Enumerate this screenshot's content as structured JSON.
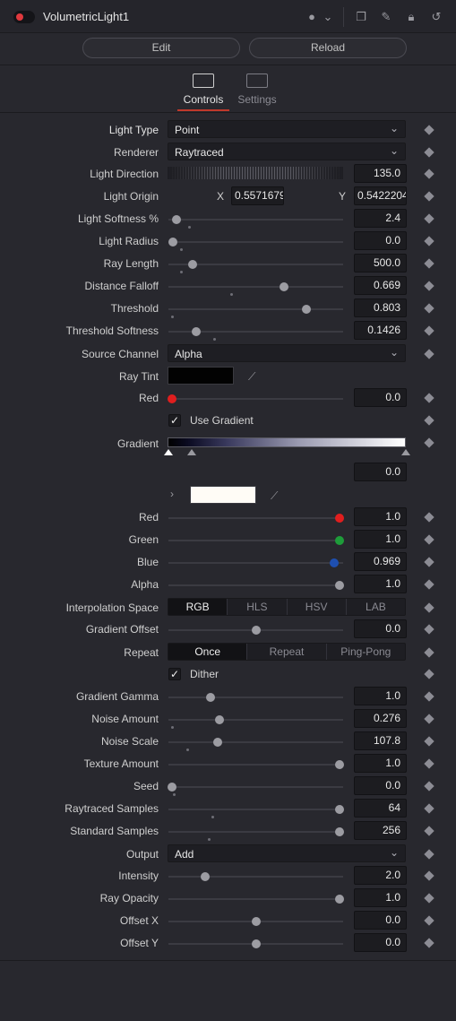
{
  "header": {
    "title": "VolumetricLight1"
  },
  "buttons": {
    "edit": "Edit",
    "reload": "Reload"
  },
  "tabs": [
    {
      "label": "Controls",
      "active": true
    },
    {
      "label": "Settings",
      "active": false
    }
  ],
  "dropdowns": {
    "light_type": {
      "label": "Light Type",
      "value": "Point"
    },
    "renderer": {
      "label": "Renderer",
      "value": "Raytraced"
    },
    "source_channel": {
      "label": "Source Channel",
      "value": "Alpha"
    },
    "output": {
      "label": "Output",
      "value": "Add"
    }
  },
  "light_direction": {
    "label": "Light Direction",
    "value": "135.0"
  },
  "light_origin": {
    "label": "Light Origin",
    "x_label": "X",
    "x": "0.5571679",
    "y_label": "Y",
    "y": "0.5422204"
  },
  "sliders": {
    "light_softness": {
      "label": "Light Softness %",
      "value": "2.4",
      "pos": 0.045,
      "sub": 0.12
    },
    "light_radius": {
      "label": "Light Radius",
      "value": "0.0",
      "pos": 0.025,
      "sub": 0.07
    },
    "ray_length": {
      "label": "Ray Length",
      "value": "500.0",
      "pos": 0.14,
      "sub": 0.07
    },
    "distance_falloff": {
      "label": "Distance Falloff",
      "value": "0.669",
      "pos": 0.66,
      "sub": 0.36
    },
    "threshold": {
      "label": "Threshold",
      "value": "0.803",
      "pos": 0.79,
      "sub": 0.02
    },
    "threshold_softness": {
      "label": "Threshold Softness",
      "value": "0.1426",
      "pos": 0.16,
      "sub": 0.26
    },
    "red": {
      "label": "Red",
      "value": "0.0",
      "pos": 0.02
    },
    "grad_red": {
      "label": "Red",
      "value": "1.0",
      "pos": 0.98
    },
    "grad_green": {
      "label": "Green",
      "value": "1.0",
      "pos": 0.98
    },
    "grad_blue": {
      "label": "Blue",
      "value": "0.969",
      "pos": 0.95
    },
    "grad_alpha": {
      "label": "Alpha",
      "value": "1.0",
      "pos": 0.98
    },
    "gradient_offset": {
      "label": "Gradient Offset",
      "value": "0.0",
      "pos": 0.5
    },
    "gradient_gamma": {
      "label": "Gradient Gamma",
      "value": "1.0",
      "pos": 0.24
    },
    "noise_amount": {
      "label": "Noise Amount",
      "value": "0.276",
      "pos": 0.29,
      "sub": 0.02
    },
    "noise_scale": {
      "label": "Noise Scale",
      "value": "107.8",
      "pos": 0.28,
      "sub": 0.11
    },
    "texture_amount": {
      "label": "Texture Amount",
      "value": "1.0",
      "pos": 0.98
    },
    "seed": {
      "label": "Seed",
      "value": "0.0",
      "pos": 0.02,
      "sub": 0.03
    },
    "raytraced_samples": {
      "label": "Raytraced Samples",
      "value": "64",
      "pos": 0.98,
      "sub": 0.25
    },
    "standard_samples": {
      "label": "Standard Samples",
      "value": "256",
      "pos": 0.98,
      "sub": 0.23
    },
    "intensity": {
      "label": "Intensity",
      "value": "2.0",
      "pos": 0.21
    },
    "ray_opacity": {
      "label": "Ray Opacity",
      "value": "1.0",
      "pos": 0.98
    },
    "offset_x": {
      "label": "Offset X",
      "value": "0.0",
      "pos": 0.5
    },
    "offset_y": {
      "label": "Offset Y",
      "value": "0.0",
      "pos": 0.5
    }
  },
  "ray_tint": {
    "label": "Ray Tint",
    "color": "#020202"
  },
  "use_gradient": {
    "label": "Use Gradient",
    "checked": true
  },
  "gradient": {
    "label": "Gradient",
    "stop_value": "0.0"
  },
  "interpolation_space": {
    "label": "Interpolation Space",
    "options": [
      "RGB",
      "HLS",
      "HSV",
      "LAB"
    ],
    "selected": "RGB"
  },
  "repeat": {
    "label": "Repeat",
    "options": [
      "Once",
      "Repeat",
      "Ping-Pong"
    ],
    "selected": "Once"
  },
  "dither": {
    "label": "Dither",
    "checked": true
  },
  "colors": {
    "accent": "#c0392b",
    "red_knob": "#e01e1e",
    "green_knob": "#1e9c3a",
    "blue_knob": "#1e4fb0",
    "panel_bg": "#28282e"
  }
}
